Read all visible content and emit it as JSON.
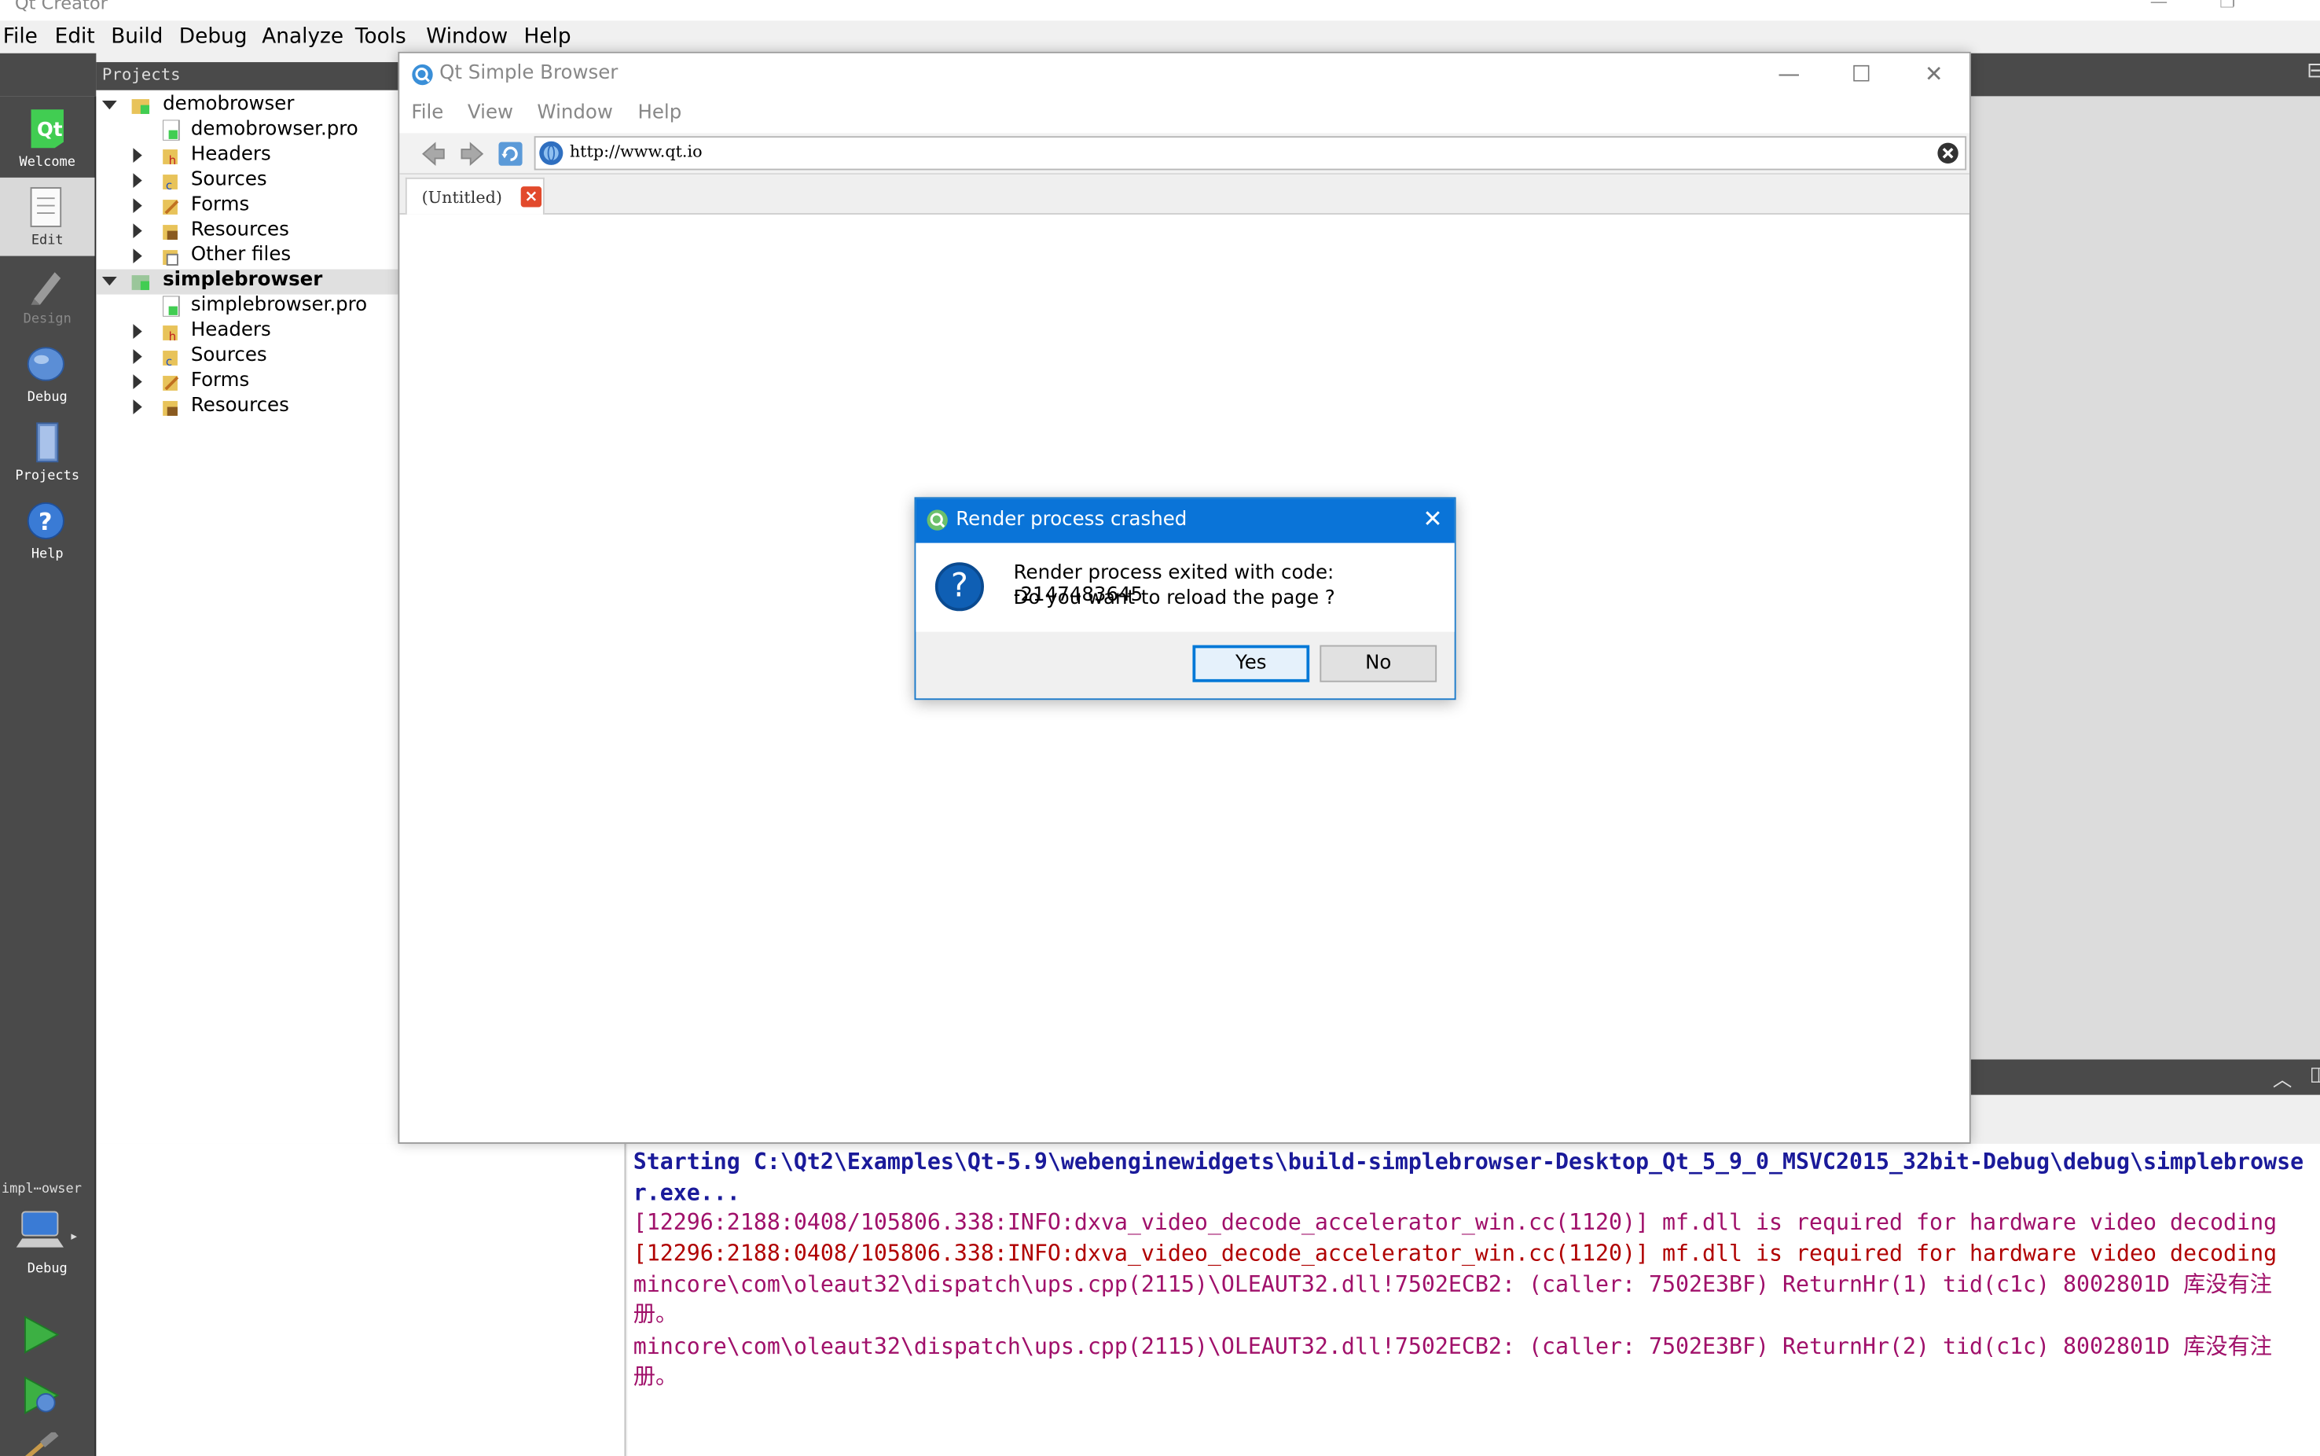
{
  "app": {
    "title": "Qt Creator",
    "menu": [
      "File",
      "Edit",
      "Build",
      "Debug",
      "Analyze",
      "Tools",
      "Window",
      "Help"
    ]
  },
  "modes": [
    {
      "label": "Welcome"
    },
    {
      "label": "Edit"
    },
    {
      "label": "Design"
    },
    {
      "label": "Debug"
    },
    {
      "label": "Projects"
    },
    {
      "label": "Help"
    }
  ],
  "kit": {
    "project": "impl⋯owser",
    "mode": "Debug"
  },
  "projects": {
    "header": "Projects",
    "tree": [
      {
        "label": "demobrowser"
      },
      {
        "label": "demobrowser.pro"
      },
      {
        "label": "Headers"
      },
      {
        "label": "Sources"
      },
      {
        "label": "Forms"
      },
      {
        "label": "Resources"
      },
      {
        "label": "Other files"
      },
      {
        "label": "simplebrowser"
      },
      {
        "label": "simplebrowser.pro"
      },
      {
        "label": "Headers"
      },
      {
        "label": "Sources"
      },
      {
        "label": "Forms"
      },
      {
        "label": "Resources"
      }
    ]
  },
  "browser": {
    "title": "Qt Simple Browser",
    "menu": [
      "File",
      "View",
      "Window",
      "Help"
    ],
    "url": "http://www.qt.io",
    "tab": "(Untitled)"
  },
  "dialog": {
    "title": "Render process crashed",
    "line1": "Render process exited with code: -2147483645",
    "line2": "Do you want to reload the page ?",
    "yes": "Yes",
    "no": "No"
  },
  "output": [
    {
      "kind": "start",
      "text": "Starting C:\\Qt2\\Examples\\Qt-5.9\\webenginewidgets\\build-simplebrowser-Desktop_Qt_5_9_0_MSVC2015_32bit-Debug\\debug\\simplebrowser.exe..."
    },
    {
      "kind": "warn",
      "text": "[12296:2188:0408/105806.338:INFO:dxva_video_decode_accelerator_win.cc(1120)] mf.dll is required for hardware video decoding"
    },
    {
      "kind": "err",
      "text": "[12296:2188:0408/105806.338:INFO:dxva_video_decode_accelerator_win.cc(1120)] mf.dll is required for hardware video decoding"
    },
    {
      "kind": "warn",
      "text": "mincore\\com\\oleaut32\\dispatch\\ups.cpp(2115)\\OLEAUT32.dll!7502ECB2: (caller: 7502E3BF) ReturnHr(1) tid(c1c) 8002801D 库没有注册。"
    },
    {
      "kind": "warn",
      "text": "mincore\\com\\oleaut32\\dispatch\\ups.cpp(2115)\\OLEAUT32.dll!7502ECB2: (caller: 7502E3BF) ReturnHr(2) tid(c1c) 8002801D 库没有注册。"
    }
  ]
}
